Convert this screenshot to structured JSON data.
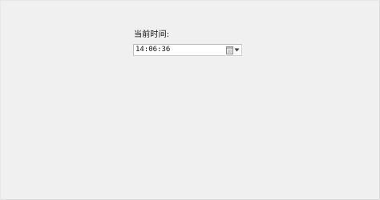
{
  "form": {
    "label": "当前时间:",
    "time_value": "14:06:36"
  },
  "icons": {
    "calendar": "calendar-icon",
    "dropdown": "chevron-down-icon"
  },
  "colors": {
    "background": "#f0f0f0",
    "field_background": "#ffffff",
    "field_border": "#cfcfcf"
  }
}
